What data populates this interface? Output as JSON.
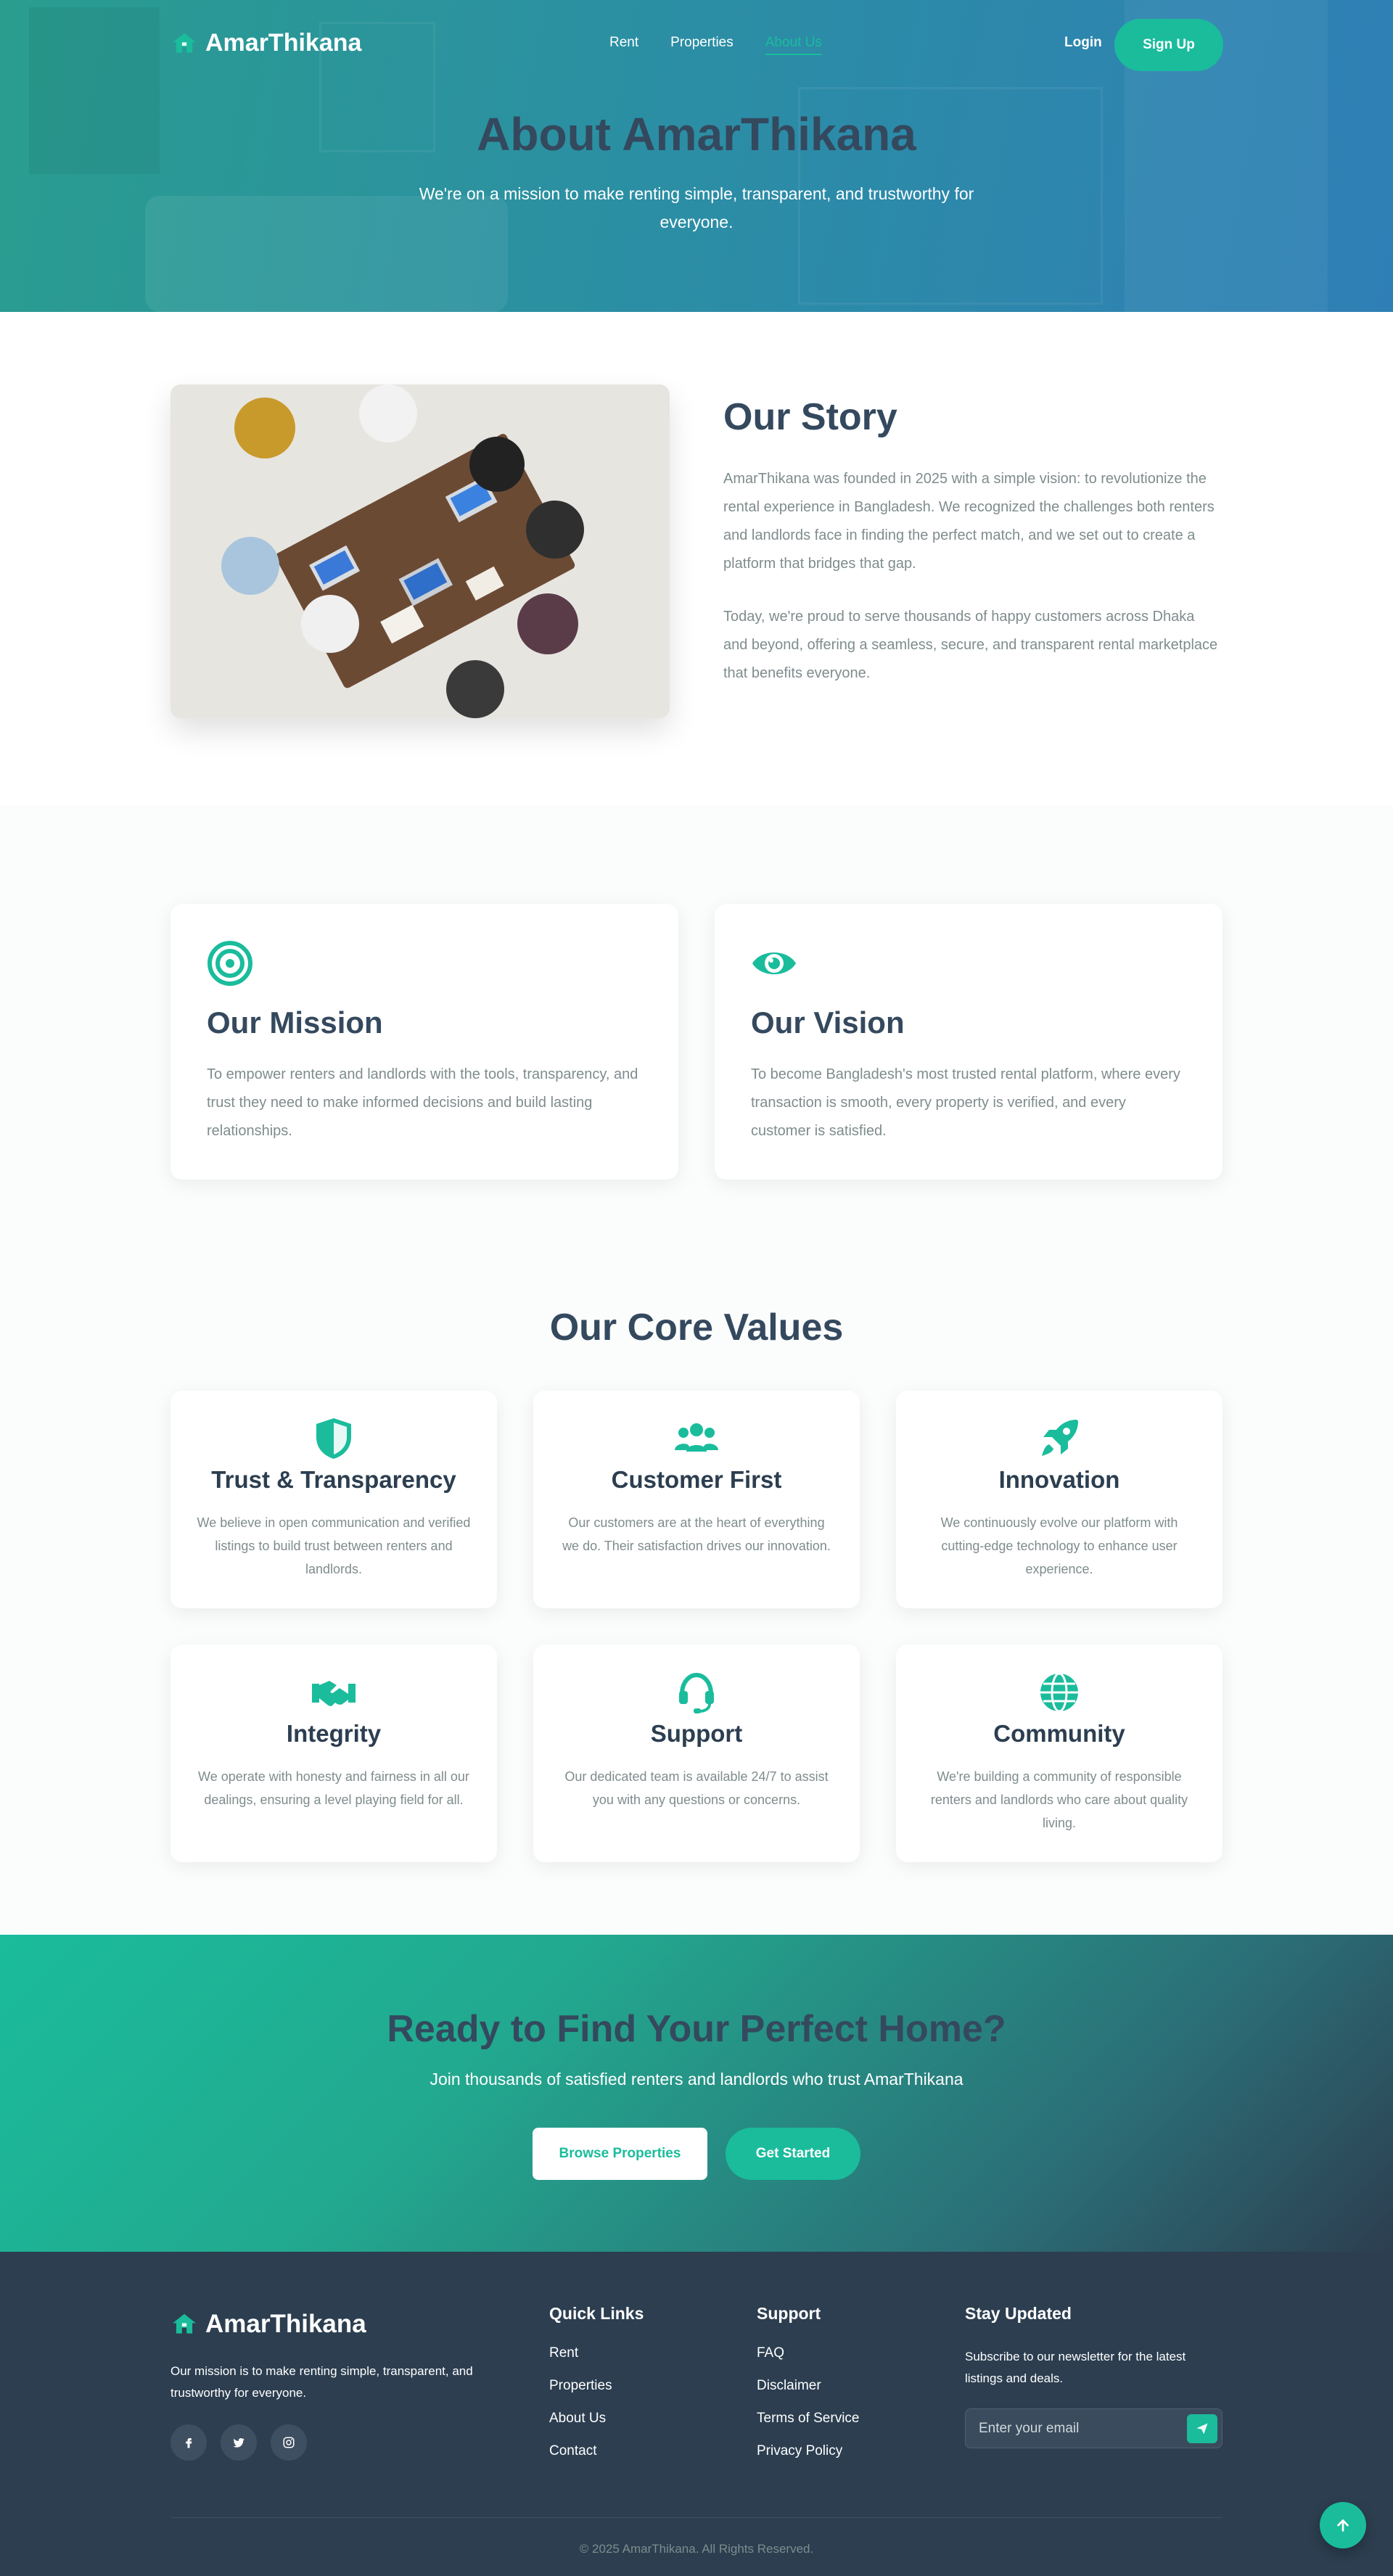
{
  "brand": {
    "name": "AmarThikana",
    "accent": "#1abc9c",
    "dark": "#2c3e50",
    "heading": "#34495e",
    "muted": "#7f8c8d"
  },
  "nav": {
    "links": [
      {
        "label": "Rent",
        "active": false
      },
      {
        "label": "Properties",
        "active": false
      },
      {
        "label": "About Us",
        "active": true
      }
    ],
    "login": "Login",
    "signup": "Sign Up"
  },
  "hero": {
    "title": "About AmarThikana",
    "subtitle": "We're on a mission to make renting simple, transparent, and trustworthy for everyone."
  },
  "story": {
    "title": "Our Story",
    "p1": "AmarThikana was founded in 2025 with a simple vision: to revolutionize the rental experience in Bangladesh. We recognized the challenges both renters and landlords face in finding the perfect match, and we set out to create a platform that bridges that gap.",
    "p2": "Today, we're proud to serve thousands of happy customers across Dhaka and beyond, offering a seamless, secure, and transparent rental marketplace that benefits everyone."
  },
  "mission": {
    "title": "Our Mission",
    "text": "To empower renters and landlords with the tools, transparency, and trust they need to make informed decisions and build lasting relationships.",
    "icon": "bullseye-icon"
  },
  "vision": {
    "title": "Our Vision",
    "text": "To become Bangladesh's most trusted rental platform, where every transaction is smooth, every property is verified, and every customer is satisfied.",
    "icon": "eye-icon"
  },
  "values": {
    "title": "Our Core Values",
    "items": [
      {
        "title": "Trust & Transparency",
        "text": "We believe in open communication and verified listings to build trust between renters and landlords.",
        "icon": "shield-icon"
      },
      {
        "title": "Customer First",
        "text": "Our customers are at the heart of everything we do. Their satisfaction drives our innovation.",
        "icon": "users-icon"
      },
      {
        "title": "Innovation",
        "text": "We continuously evolve our platform with cutting-edge technology to enhance user experience.",
        "icon": "rocket-icon"
      },
      {
        "title": "Integrity",
        "text": "We operate with honesty and fairness in all our dealings, ensuring a level playing field for all.",
        "icon": "handshake-icon"
      },
      {
        "title": "Support",
        "text": "Our dedicated team is available 24/7 to assist you with any questions or concerns.",
        "icon": "headset-icon"
      },
      {
        "title": "Community",
        "text": "We're building a community of responsible renters and landlords who care about quality living.",
        "icon": "globe-icon"
      }
    ]
  },
  "cta": {
    "title": "Ready to Find Your Perfect Home?",
    "subtitle": "Join thousands of satisfied renters and landlords who trust AmarThikana",
    "browse": "Browse Properties",
    "start": "Get Started"
  },
  "footer": {
    "mission": "Our mission is to make renting simple, transparent, and trustworthy for everyone.",
    "quick_links": {
      "title": "Quick Links",
      "items": [
        "Rent",
        "Properties",
        "About Us",
        "Contact"
      ]
    },
    "support": {
      "title": "Support",
      "items": [
        "FAQ",
        "Disclaimer",
        "Terms of Service",
        "Privacy Policy"
      ]
    },
    "newsletter": {
      "title": "Stay Updated",
      "text": "Subscribe to our newsletter for the latest listings and deals.",
      "placeholder": "Enter your email"
    },
    "socials": [
      "facebook-icon",
      "twitter-icon",
      "instagram-icon"
    ],
    "copyright": "© 2025 AmarThikana. All Rights Reserved."
  }
}
